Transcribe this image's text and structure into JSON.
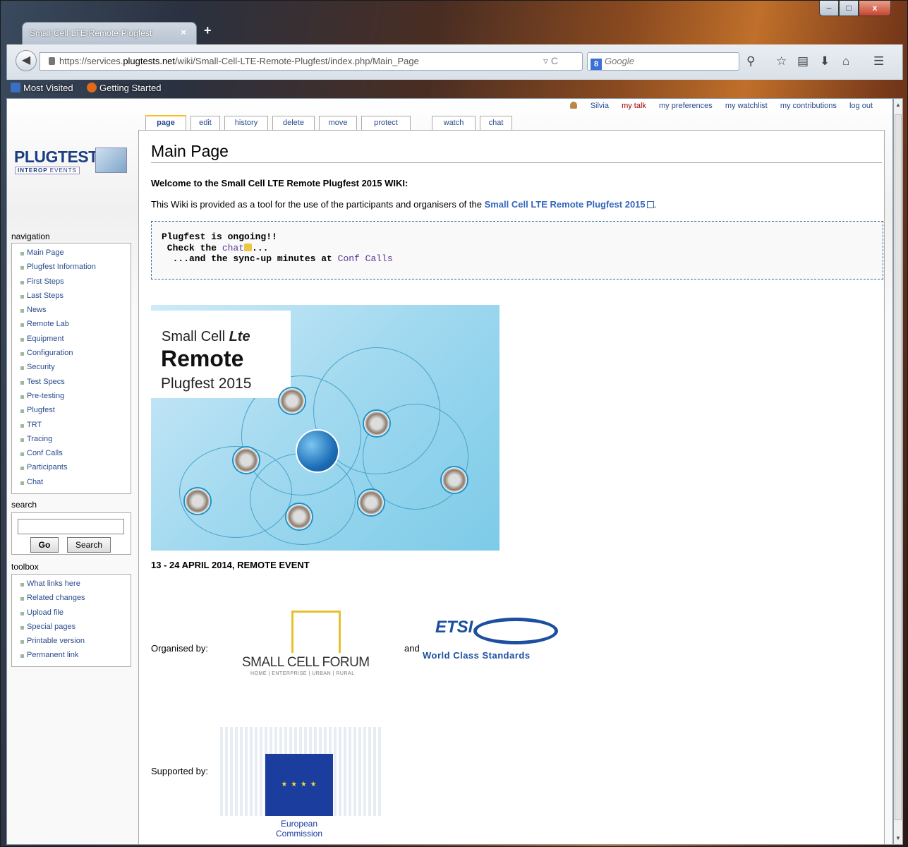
{
  "browser": {
    "tab_title": "Small-Cell-LTE-Remote-Plugfest",
    "tab_close": "×",
    "new_tab": "+",
    "window_controls": {
      "minimize": "–",
      "maximize": "□",
      "close": "x"
    },
    "url_prefix": "https://services.",
    "url_domain": "plugtests.net",
    "url_path": "/wiki/Small-Cell-LTE-Remote-Plugfest/index.php/Main_Page",
    "search_engine_badge": "8",
    "search_placeholder": "Google",
    "bookmarks": [
      "Most Visited",
      "Getting Started"
    ]
  },
  "personal_tools": {
    "user": "Silvia",
    "items": [
      "my talk",
      "my preferences",
      "my watchlist",
      "my contributions",
      "log out"
    ]
  },
  "page_tabs": [
    "page",
    "edit",
    "history",
    "delete",
    "move",
    "protect",
    "watch",
    "chat"
  ],
  "logo": {
    "name": "PLUGTESTS",
    "sub_bold": "INTEROP",
    "sub": " EVENTS"
  },
  "sidebar": {
    "navigation_title": "navigation",
    "navigation": [
      "Main Page",
      "Plugfest Information",
      "First Steps",
      "Last Steps",
      "News",
      "Remote Lab",
      "Equipment",
      "Configuration",
      "Security",
      "Test Specs",
      "Pre-testing",
      "Plugfest",
      "TRT",
      "Tracing",
      "Conf Calls",
      "Participants",
      "Chat"
    ],
    "search_title": "search",
    "go_label": "Go",
    "search_label": "Search",
    "toolbox_title": "toolbox",
    "toolbox": [
      "What links here",
      "Related changes",
      "Upload file",
      "Special pages",
      "Printable version",
      "Permanent link"
    ]
  },
  "main": {
    "title": "Main Page",
    "welcome": "Welcome to the Small Cell LTE Remote Plugfest 2015 WIKI:",
    "intro": "This Wiki is provided as a tool for the use of the participants and organisers of the ",
    "intro_link": "Small Cell LTE Remote Plugfest 2015",
    "intro_end": ".",
    "note_line1": "Plugfest is ongoing!!",
    "note_line2_pre": " Check the ",
    "note_line2_link": "chat",
    "note_line2_post": "...",
    "note_line3_pre": "  ...and the sync-up minutes at ",
    "note_line3_link": "Conf Calls",
    "banner": {
      "line1": "Small Cell ",
      "lte": "Lte",
      "line2": "Remote",
      "line3": "Plugfest 2015"
    },
    "event_caption": "13 - 24 APRIL 2014, REMOTE EVENT",
    "organised_by": "Organised by:",
    "and": "and",
    "scf_name": "SMALL CELL FORUM",
    "scf_sub": "HOME | ENTERPRISE | URBAN | RURAL",
    "etsi_name": "ETSI",
    "etsi_tagline": "World Class Standards",
    "supported_by": "Supported by:",
    "ec_line1": "European",
    "ec_line2": "Commission"
  },
  "colors": {
    "link": "#2a4b8d",
    "accent_tab": "#fabd23",
    "note_border": "#2f6fab"
  }
}
